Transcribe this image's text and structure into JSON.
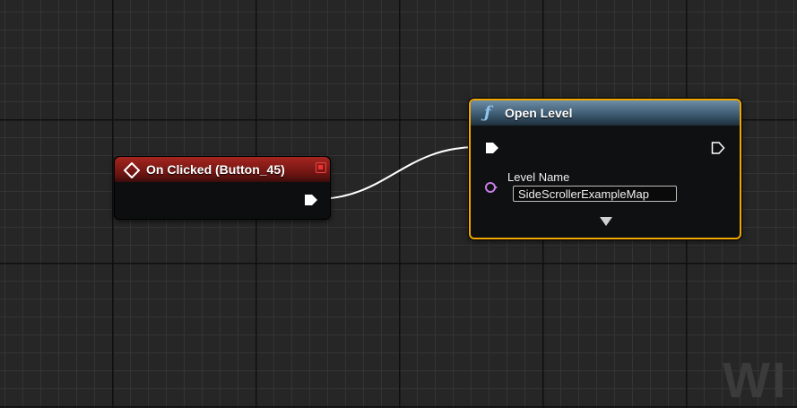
{
  "event_node": {
    "title": "On Clicked (Button_45)",
    "header_color": "#8f1f1a"
  },
  "function_node": {
    "title": "Open Level",
    "icon": "function-icon",
    "selected_outline_color": "#f1a700",
    "param_label": "Level Name",
    "param_value": "SideScrollerExampleMap"
  },
  "watermark": "WI"
}
